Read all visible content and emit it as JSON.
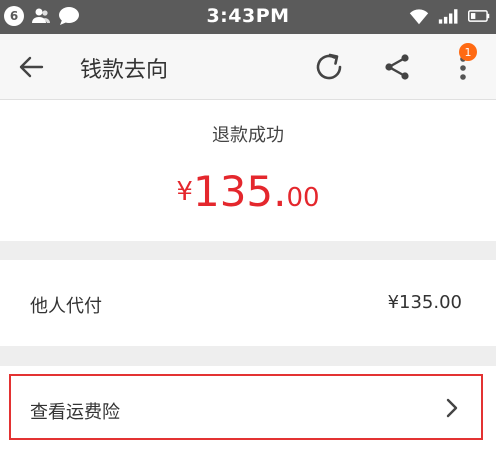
{
  "status_bar": {
    "notification_count": "6",
    "time": "3:43PM",
    "icons": [
      "contacts-icon",
      "chat-bubble-icon",
      "wifi-icon",
      "signal-icon",
      "battery-icon"
    ]
  },
  "header": {
    "title": "钱款去向",
    "notification_badge": "1",
    "icons": [
      "back-arrow-icon",
      "refresh-icon",
      "share-icon",
      "more-vertical-icon"
    ]
  },
  "refund": {
    "status": "退款成功",
    "amount_currency": "¥",
    "amount_integer": "135.",
    "amount_decimal": "00",
    "amount_color": "#e4272d"
  },
  "payment": {
    "label": "他人代付",
    "value": "¥135.00"
  },
  "insurance": {
    "label": "查看运费险",
    "highlight_color": "#e33232"
  },
  "colors": {
    "status_bar_bg": "#5b5b5b",
    "header_bg": "#f7f7f7",
    "badge": "#ff6a13",
    "section_gap": "#eeeeee"
  }
}
